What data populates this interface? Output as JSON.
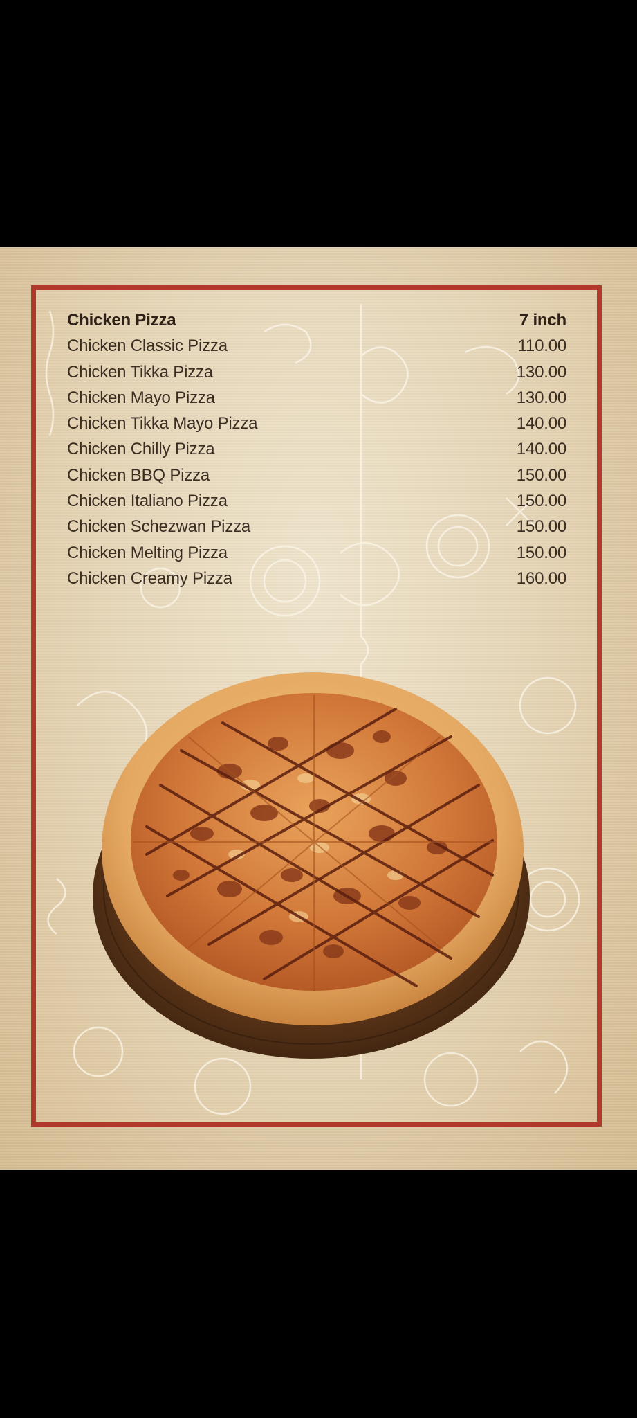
{
  "menu": {
    "section_title": "Chicken Pizza",
    "size_label": "7 inch",
    "items": [
      {
        "name": "Chicken Classic Pizza",
        "price": "110.00"
      },
      {
        "name": "Chicken Tikka Pizza",
        "price": "130.00"
      },
      {
        "name": "Chicken Mayo Pizza",
        "price": "130.00"
      },
      {
        "name": "Chicken Tikka Mayo Pizza",
        "price": "140.00"
      },
      {
        "name": "Chicken Chilly Pizza",
        "price": "140.00"
      },
      {
        "name": "Chicken BBQ Pizza",
        "price": "150.00"
      },
      {
        "name": "Chicken Italiano Pizza",
        "price": "150.00"
      },
      {
        "name": "Chicken Schezwan Pizza",
        "price": "150.00"
      },
      {
        "name": "Chicken Melting Pizza",
        "price": "150.00"
      },
      {
        "name": "Chicken Creamy Pizza",
        "price": "160.00"
      }
    ]
  },
  "colors": {
    "frame_border": "#b0392b",
    "background": "#e6d6b7",
    "text": "#3a2d22"
  }
}
